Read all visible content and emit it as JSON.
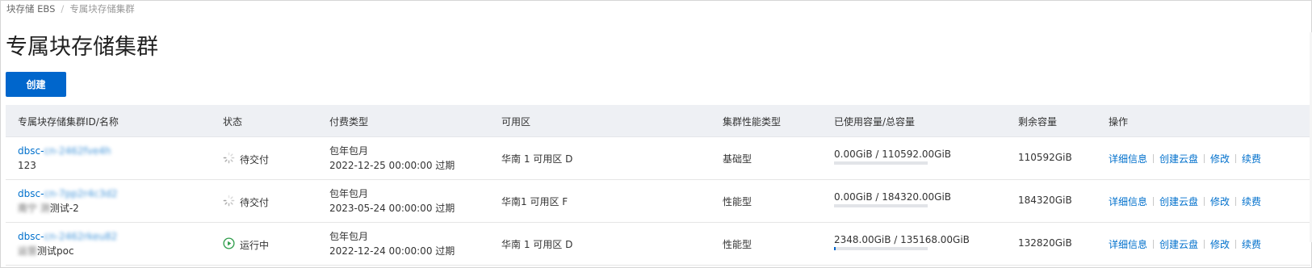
{
  "breadcrumb": {
    "root": "块存储 EBS",
    "separator": "/",
    "current": "专属块存储集群"
  },
  "page": {
    "title": "专属块存储集群",
    "create_label": "创建"
  },
  "table": {
    "columns": [
      "专属块存储集群ID/名称",
      "状态",
      "付费类型",
      "可用区",
      "集群性能类型",
      "已使用容量/总容量",
      "剩余容量",
      "操作"
    ],
    "rows": [
      {
        "id_prefix": "dbsc-",
        "id_masked": "cn-2462fve4h",
        "name_masked": "",
        "name": "123",
        "status": "待交付",
        "status_icon": "spinner-icon",
        "pay_type": "包年包月",
        "expire": "2022-12-25 00:00:00 过期",
        "zone": "华南 1 可用区 D",
        "perf": "基础型",
        "capacity": "0.00GiB / 110592.00GiB",
        "used_fraction": 0.0,
        "remaining": "110592GiB",
        "ops": [
          "详细信息",
          "创建云盘",
          "修改",
          "续费"
        ]
      },
      {
        "id_prefix": "dbsc-",
        "id_masked": "cn-7pp2r4c3d2",
        "name_masked": "南宁 测",
        "name": "测试-2",
        "status": "待交付",
        "status_icon": "spinner-icon",
        "pay_type": "包年包月",
        "expire": "2023-05-24 00:00:00 过期",
        "zone": "华南1 可用区 F",
        "perf": "性能型",
        "capacity": "0.00GiB / 184320.00GiB",
        "used_fraction": 0.0,
        "remaining": "184320GiB",
        "ops": [
          "详细信息",
          "创建云盘",
          "修改",
          "续费"
        ]
      },
      {
        "id_prefix": "dbsc-",
        "id_masked": "cn-2462rkeu82",
        "name_masked": "运营",
        "name": "测试poc",
        "status": "运行中",
        "status_icon": "play-circle-icon",
        "pay_type": "包年包月",
        "expire": "2022-12-24 00:00:00 过期",
        "zone": "华南 1 可用区 D",
        "perf": "性能型",
        "capacity": "2348.00GiB / 135168.00GiB",
        "used_fraction": 0.0174,
        "remaining": "132820GiB",
        "ops": [
          "详细信息",
          "创建云盘",
          "修改",
          "续费"
        ]
      }
    ]
  },
  "colors": {
    "accent": "#0066cc",
    "link": "#0070cc",
    "running": "#2e9c4a",
    "header_bg": "#eef0f4"
  }
}
